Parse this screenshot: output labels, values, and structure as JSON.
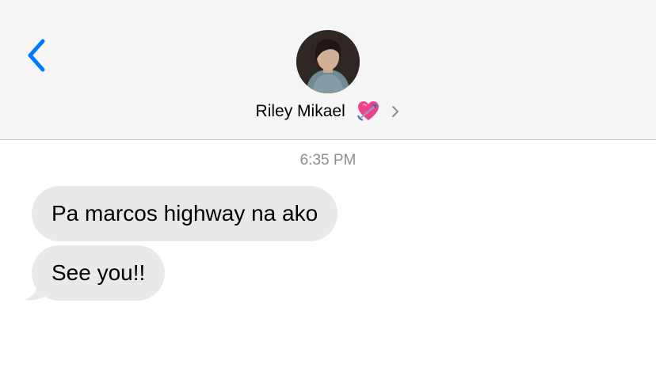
{
  "header": {
    "back_icon": "chevron-left-icon",
    "contact_name": "Riley Mikael",
    "contact_emoji_icon": "heart-with-arrow-icon",
    "details_icon": "chevron-right-icon",
    "accent_color": "#007aff"
  },
  "conversation": {
    "timestamp": "6:35 PM",
    "messages": [
      {
        "text": "Pa marcos highway na ako",
        "direction": "received"
      },
      {
        "text": "See you!!",
        "direction": "received"
      }
    ],
    "bubble_color": "#e9e9eb"
  }
}
